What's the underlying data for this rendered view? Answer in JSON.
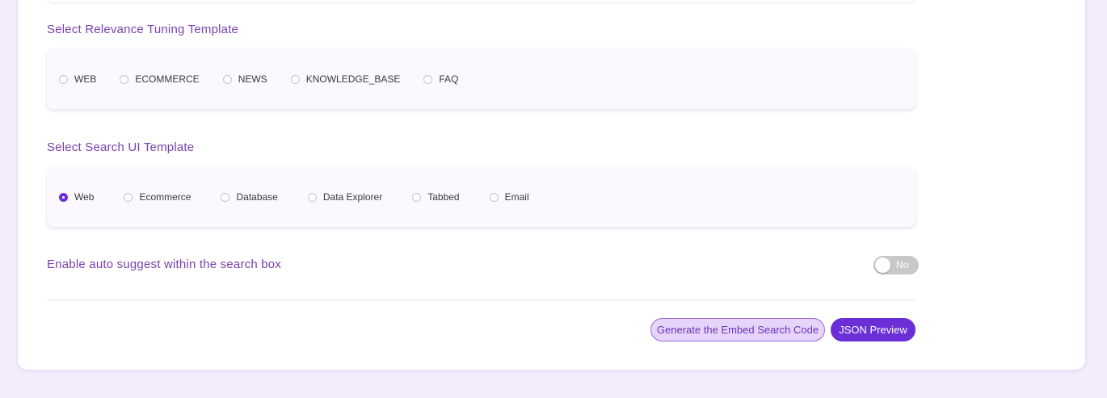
{
  "relevance": {
    "title": "Select Relevance Tuning Template",
    "options": [
      "WEB",
      "ECOMMERCE",
      "NEWS",
      "KNOWLEDGE_BASE",
      "FAQ"
    ],
    "selected": null
  },
  "search_ui": {
    "title": "Select Search UI Template",
    "options": [
      "Web",
      "Ecommerce",
      "Database",
      "Data Explorer",
      "Tabbed",
      "Email"
    ],
    "selected": "Web"
  },
  "autosuggest": {
    "label": "Enable auto suggest within the search box",
    "toggle_text": "No"
  },
  "actions": {
    "generate_label": "Generate the Embed Search Code",
    "json_preview_label": "JSON Preview"
  },
  "colors": {
    "accent": "#6a2fd6",
    "title": "#7a3fb0",
    "background": "#f3ecfb"
  }
}
